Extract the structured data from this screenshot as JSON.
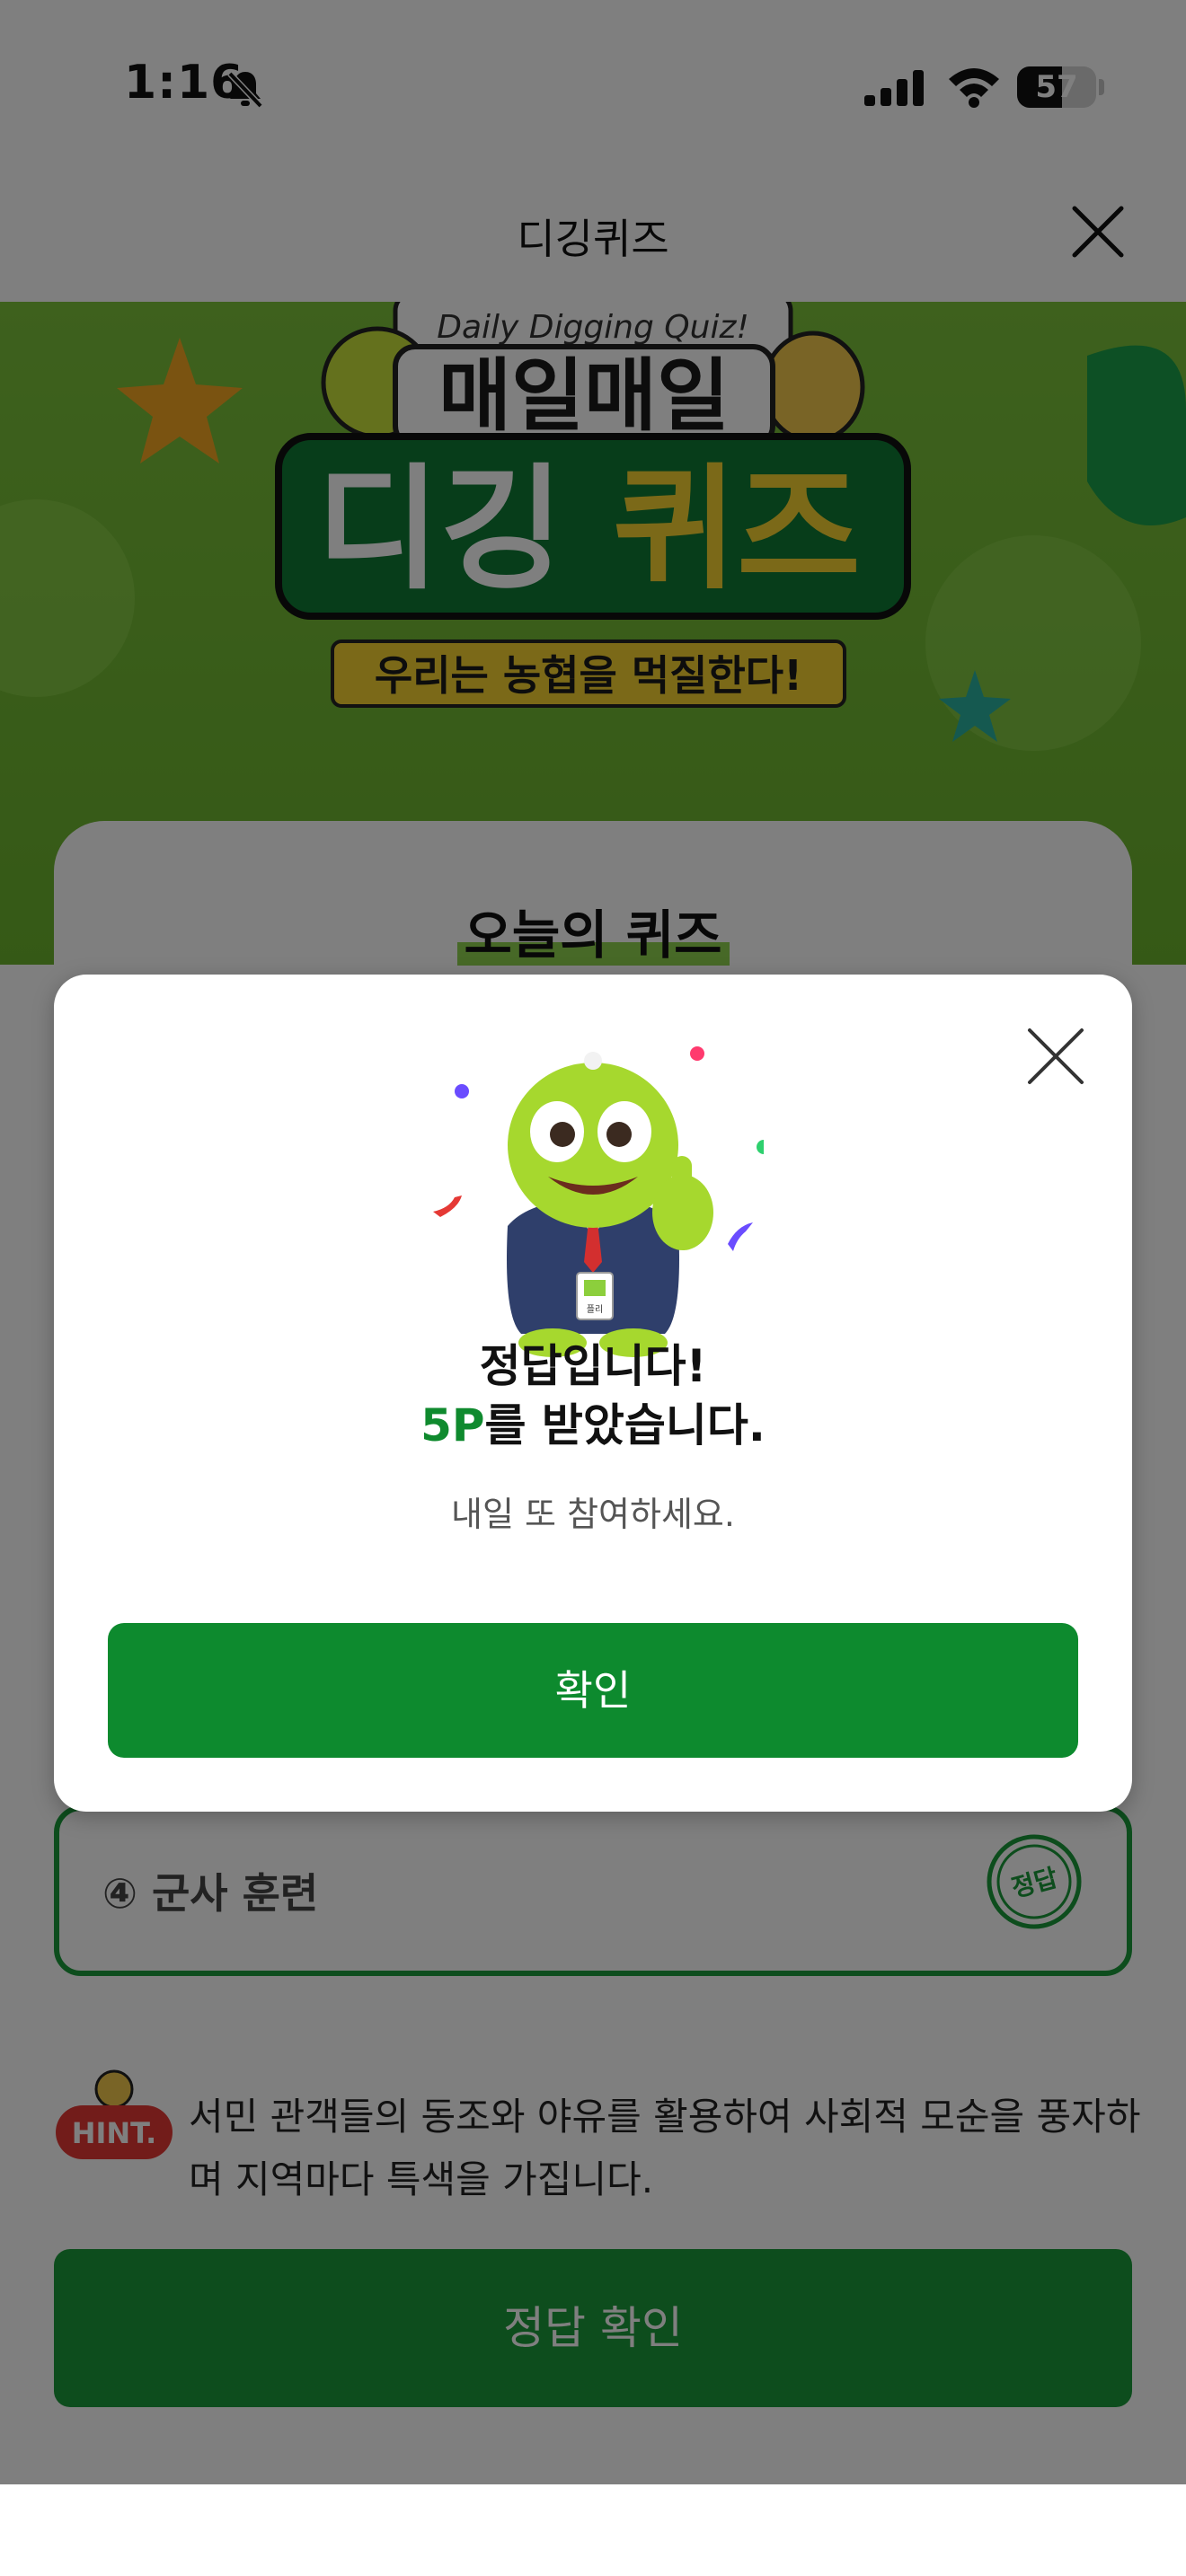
{
  "status_bar": {
    "time": "1:16",
    "battery": "57",
    "battery_fraction": 0.57
  },
  "header": {
    "title": "디깅퀴즈"
  },
  "banner": {
    "subtitle_en": "Daily Digging Quiz!",
    "title_line1": "매일매일",
    "title_line2_a": "디깅",
    "title_line2_b": "퀴즈",
    "tagline": "우리는 농협을 먹질한다!"
  },
  "quiz": {
    "section_title": "오늘의 퀴즈",
    "option4": "④ 군사 훈련",
    "stamp_label": "정답",
    "hint_label": "HINT.",
    "hint_text": "서민 관객들의 동조와 야유를 활용하여 사회적 모순을 풍자하며 지역마다 특색을 가집니다.",
    "submit_label": "정답 확인"
  },
  "modal": {
    "line1": "정답입니다!",
    "points": "5P",
    "line2_rest": "를 받았습니다.",
    "sub": "내일 또 참여하세요.",
    "confirm_label": "확인",
    "badge_text": "플리"
  },
  "colors": {
    "brand_green": "#0d8a2e",
    "banner_green": "#7cc23b",
    "points_green": "#0f8a2e"
  }
}
